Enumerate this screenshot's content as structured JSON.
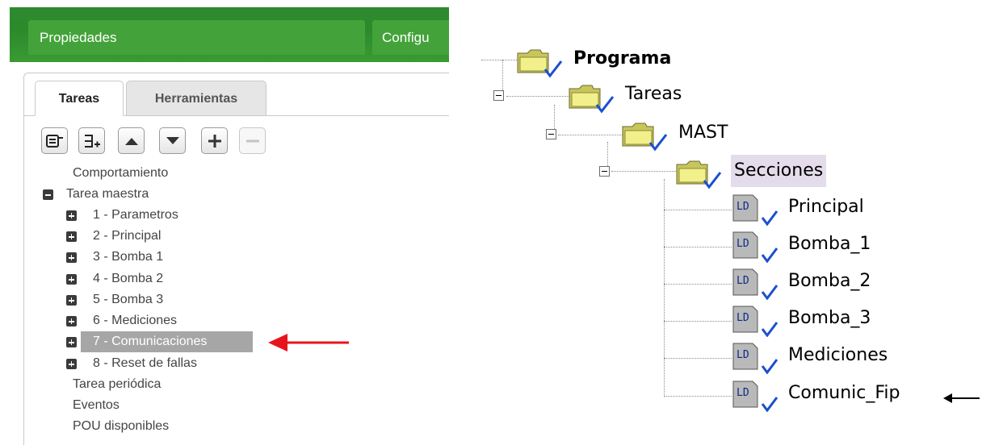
{
  "header": {
    "tabs": [
      "Propiedades",
      "Configu"
    ]
  },
  "left_tabs": [
    "Tareas",
    "Herramientas"
  ],
  "toolbar": [
    "collapse-all",
    "expand-all",
    "move-up",
    "move-down",
    "add",
    "remove"
  ],
  "tree": {
    "comportamiento": "Comportamiento",
    "tarea_maestra": "Tarea maestra",
    "sections": [
      "1 - Parametros",
      "2 - Principal",
      "3 - Bomba 1",
      "4 - Bomba 2",
      "5 - Bomba 3",
      "6 - Mediciones",
      "7 - Comunicaciones",
      "8 - Reset de fallas"
    ],
    "selected": "7 - Comunicaciones",
    "tarea_periodica": "Tarea periódica",
    "eventos": "Eventos",
    "pou": "POU disponibles"
  },
  "arrow_left_color": "#e8141c",
  "arrow_right_color": "#000000",
  "project_tree": {
    "programa": "Programa",
    "tareas": "Tareas",
    "mast": "MAST",
    "secciones": "Secciones",
    "ld_badge": "LD",
    "items": [
      "Principal",
      "Bomba_1",
      "Bomba_2",
      "Bomba_3",
      "Mediciones",
      "Comunic_Fip"
    ]
  }
}
